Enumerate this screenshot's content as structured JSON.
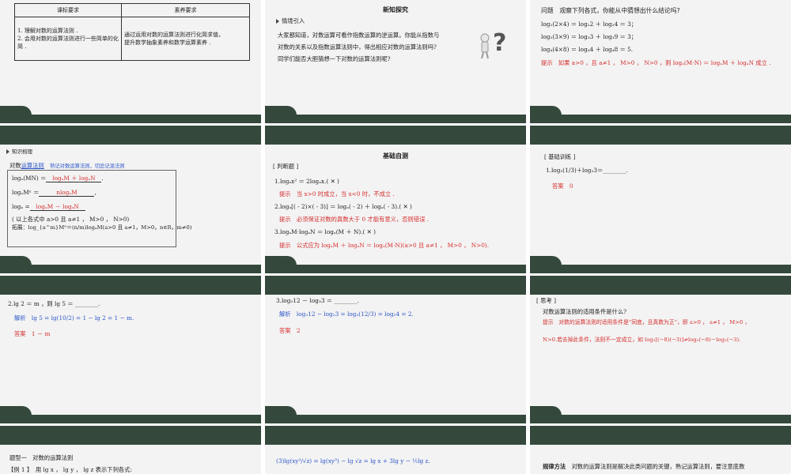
{
  "s1": {
    "col1": "课标要求",
    "col2": "素养要求",
    "req1": "1. 理解对数的运算法则 .",
    "req2": "2. 会用对数的运算法则进行一些简单的化简 .",
    "lit1": "通过运用对数的运算法则进行化简求值，",
    "lit2": "提升数学抽象素养和数学运算素养 ."
  },
  "s2": {
    "title": "新知探究",
    "sub": "情境引入",
    "p1": "大家都知道，对数运算可看作指数运算的逆运算。你能从指数与",
    "p2": "对数的关系以及指数运算法则中，得出相应对数的运算法则吗?",
    "p3": "同学们能否大胆猜想一下对数的运算法则呢?"
  },
  "s3": {
    "q": "问题　观察下列各式，你能从中猜想出什么结论吗?",
    "e1": "log₂(2×4) ＝ log₂2 ＋ log₂4 ＝ 3；",
    "e2": "log₃(3×9) ＝ log₃3 ＋ log₃9 ＝ 3；",
    "e3": "log₄(4×8) ＝ log₄4 ＋ log₄8 ＝ 5.",
    "hint": "提示　如果 a>0 ，且 a≠1 ， M>0 ， N>0 ，则 logₐ(M·N) ＝ logₐM ＋ logₐN 成立 ."
  },
  "s4": {
    "sub": "知识梳理",
    "heading": "对数",
    "link": "运算法则",
    "note": "熟记对数运算法则，切忌记混法则",
    "r1": "logₐ(MN) ＝",
    "a1": "logₐM ＋ logₐN",
    "r2": "logₐMⁿ ＝",
    "a2": "nlogₐM",
    "r3": "logₐ =",
    "a3": "logₐM － logₐN",
    "cond": "( 以上各式中 a>0 且 a≠1 ，  M>0 ，  N>0)",
    "ext": "拓展：log_{a^m}Mⁿ＝(n/m)logₐM(a>0 且 a≠1，M>0，n∈R，m≠0)"
  },
  "s5": {
    "title": "基础自测",
    "tag": "[ 判断题 ]",
    "j1": "1.logₐx² ＝ 2logₐx.(  ✕  )",
    "h1": "提示　当 x>0 时成立，当 x<0 时，不成立 .",
    "j2": "2.logₐ[( - 2)×( - 3)] ＝ logₐ( - 2) ＋ logₐ( - 3).(  ✕  )",
    "h2": "提示　必须保证对数的真数大于 0 才能有意义，否则错误 .",
    "j3": "3.logₐM·logₐN ＝ logₐ(M ＋ N).(  ✕  )",
    "h3": "提示　公式应为 logₐM ＋ logₐN ＝ logₐ(M·N)(a>0 且 a≠1 ， M>0 ， N>0)."
  },
  "s6": {
    "tag": "[ 基础训练 ]",
    "q": "1.log₃(1/3)＋log₃3＝________.",
    "ans_label": "答案",
    "ans": "0"
  },
  "s7": {
    "q": "2.lg 2 ＝ m ，则 lg 5 ＝ ________.",
    "sol_label": "解析",
    "sol": "lg 5 = lg(10/2) = 1 − lg 2 = 1 − m.",
    "ans_label": "答案",
    "ans": "1 － m"
  },
  "s8": {
    "q": "3.log₃12 － log₃3 ＝ ________.",
    "sol_label": "解析",
    "sol": "log₃12 − log₃3 = log₃(12/3) = log₃4 = 2.",
    "ans_label": "答案",
    "ans": "2"
  },
  "s9": {
    "tag": "[ 思考 ]",
    "q": "对数运算法则的适用条件是什么?",
    "hint1": "提示　对数的运算法则的适用条件是“同底，且真数为正”，即 a>0 ， a≠1 ， M>0 ，",
    "hint2": "N>0.若去掉此条件，法则不一定成立，如 log₂[(−8)(−3)]≠log₂(−8)－log₂(−3)."
  },
  "s10": {
    "title": "题型一　对数的运算法则",
    "ex": "【例 1 】　用 lg x ，  lg y ，  lg z 表示下列各式:"
  },
  "s11": {
    "text": "(3)lg(xy³/√z) = lg(xy³) − lg √z = lg x + 3lg y − ½lg z."
  },
  "s12": {
    "label": "规律方法",
    "text": "对数的运算法则是解决此类问题的关键，熟记运算法则，要注意底数"
  }
}
